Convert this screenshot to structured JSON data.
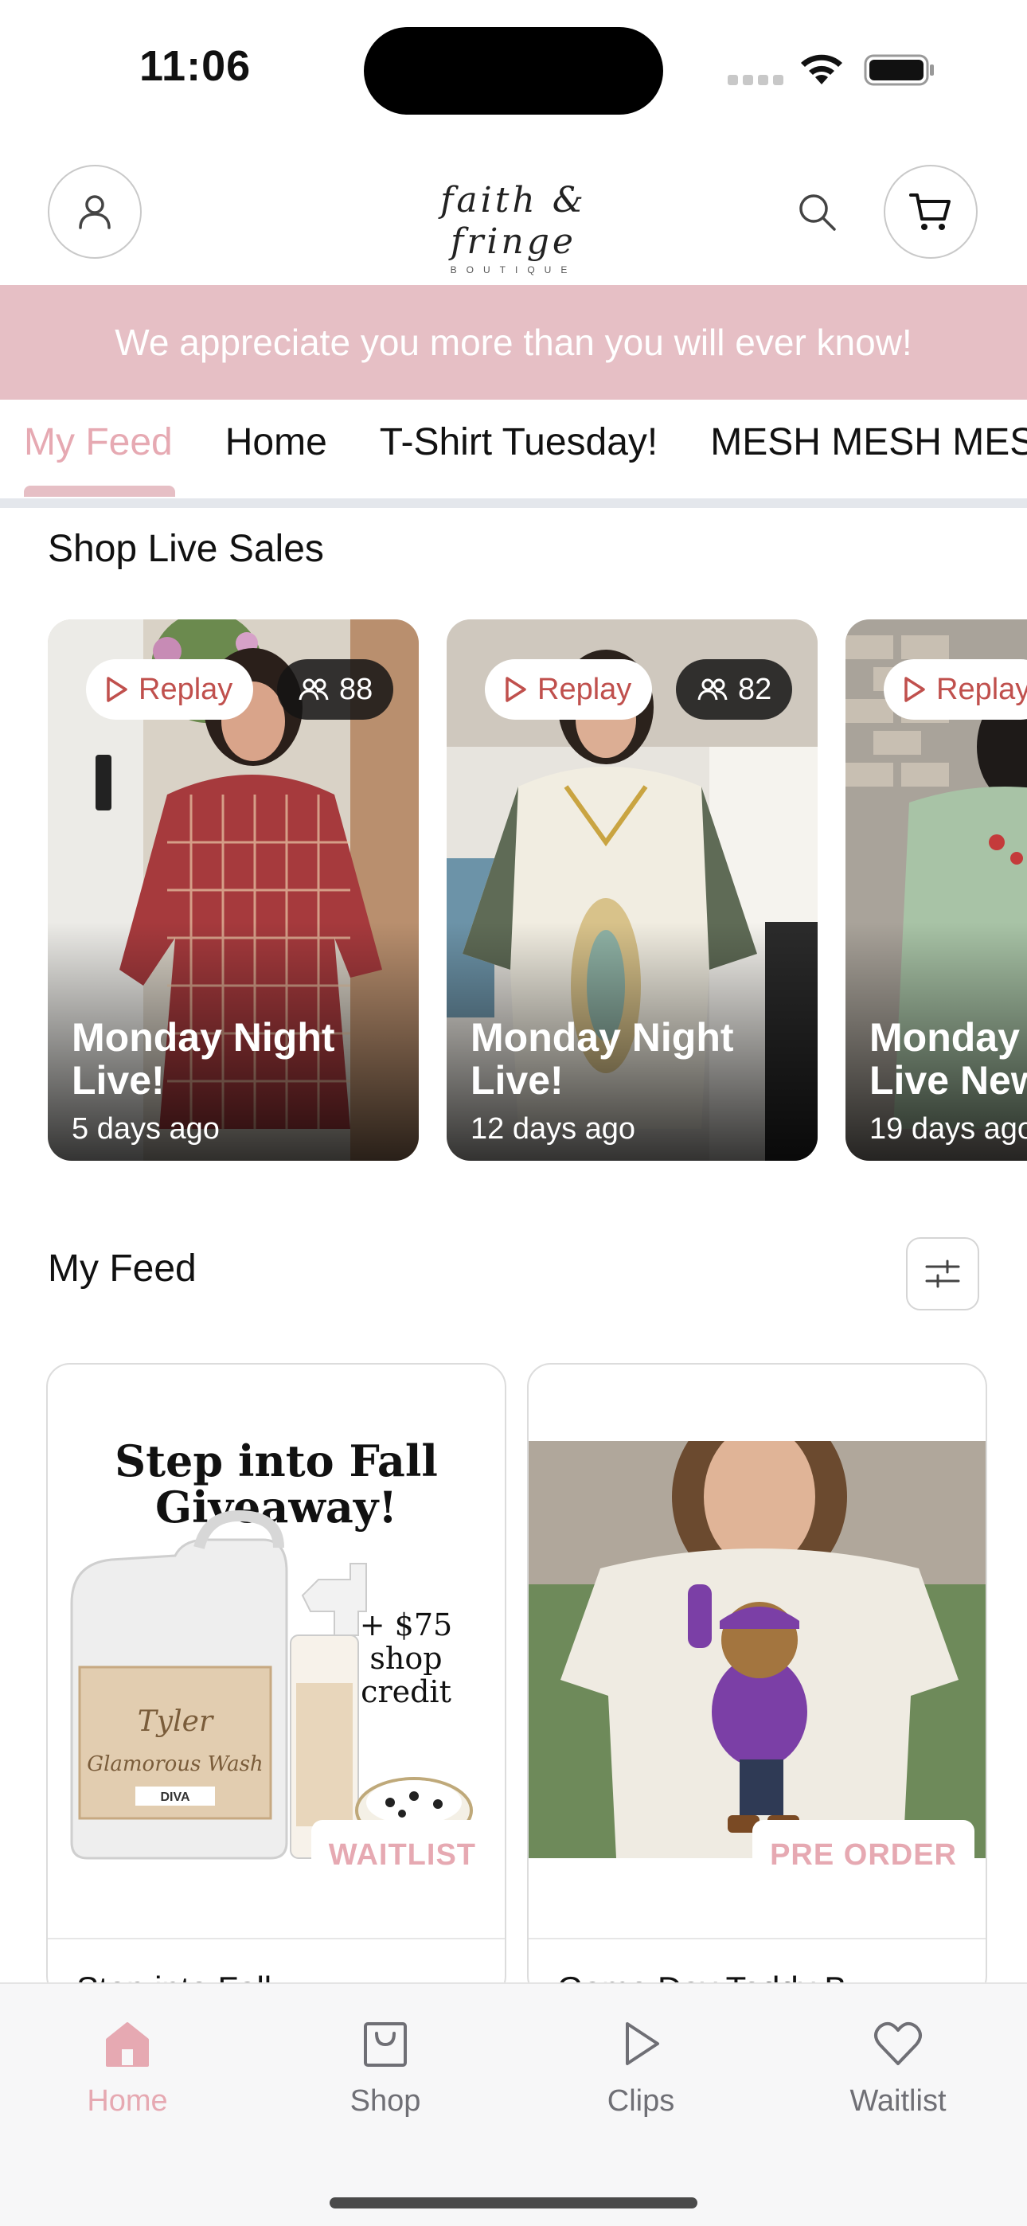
{
  "status_bar": {
    "time": "11:06"
  },
  "header": {
    "logo_main": "faith & fringe",
    "logo_sub": "BOUTIQUE"
  },
  "announcement": "We appreciate you more than you will ever know!",
  "tabs": [
    {
      "label": "My Feed",
      "active": true
    },
    {
      "label": "Home"
    },
    {
      "label": "T-Shirt Tuesday!"
    },
    {
      "label": "MESH MESH MESH"
    }
  ],
  "live_sales": {
    "title": "Shop Live Sales",
    "items": [
      {
        "replay_label": "Replay",
        "viewers": "88",
        "title": "Monday Night Live!",
        "time": "5 days ago"
      },
      {
        "replay_label": "Replay",
        "viewers": "82",
        "title": "Monday Night Live!",
        "time": "12 days ago"
      },
      {
        "replay_label": "Replay",
        "viewers": "",
        "title": "Monday Night Live New",
        "time": "19 days ago"
      }
    ]
  },
  "feed": {
    "title": "My Feed",
    "products": [
      {
        "headline": "Step into Fall Giveaway!",
        "promo_lines": [
          "+ $75",
          "shop",
          "credit"
        ],
        "badge": "WAITLIST",
        "name": "Step into Fall"
      },
      {
        "badge": "PRE ORDER",
        "name": "Game Day Teddy B"
      }
    ]
  },
  "bottom_nav": [
    {
      "label": "Home",
      "icon": "home-icon",
      "active": true
    },
    {
      "label": "Shop",
      "icon": "shop-bag-icon"
    },
    {
      "label": "Clips",
      "icon": "play-icon"
    },
    {
      "label": "Waitlist",
      "icon": "heart-icon"
    }
  ],
  "colors": {
    "accent_pink": "#e6a9b2",
    "banner_pink": "#e6bfc5",
    "replay_red": "#c0504d"
  }
}
